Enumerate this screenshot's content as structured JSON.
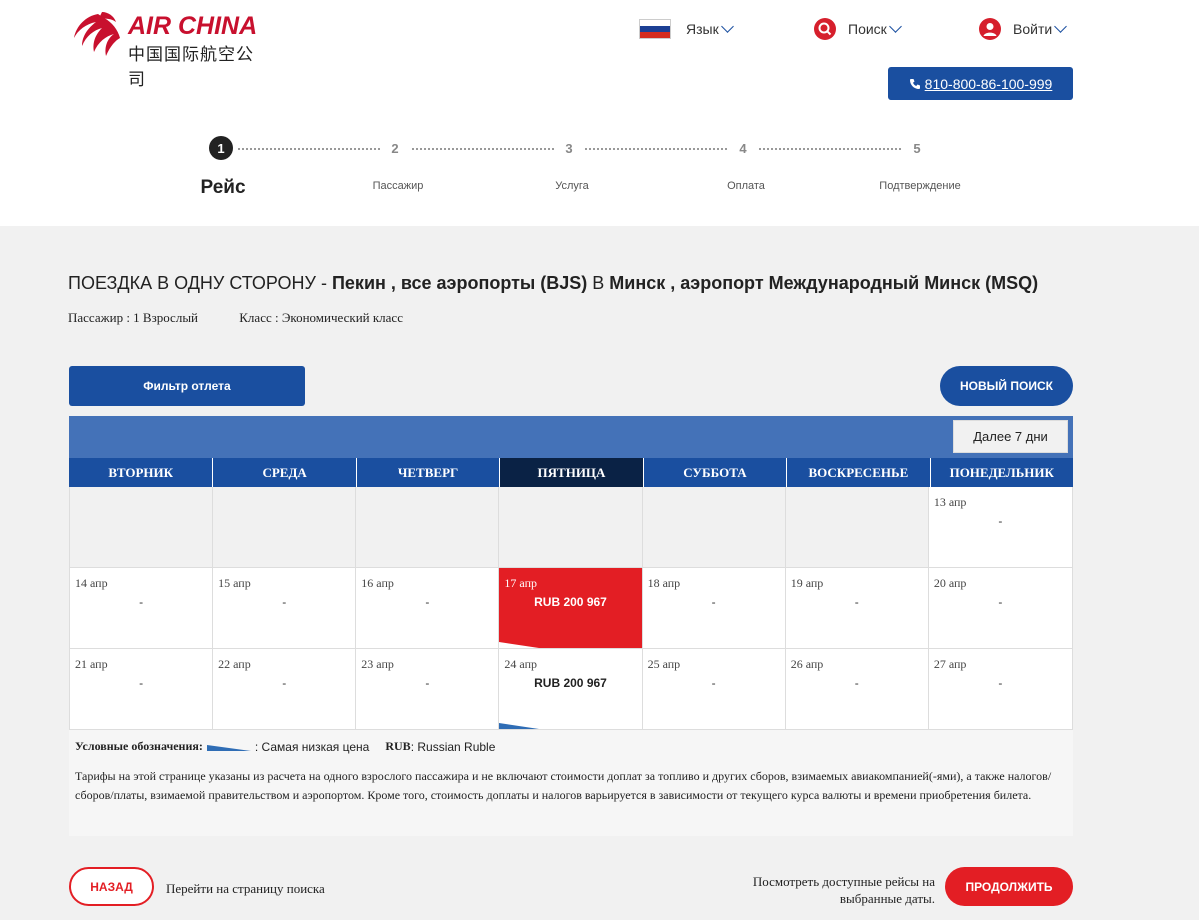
{
  "brand": {
    "name": "AIR CHINA",
    "name_cn": "中国国际航空公司",
    "color": "#c8102e"
  },
  "topnav": {
    "language_label": "Язык",
    "search_label": "Поиск",
    "login_label": "Войти",
    "phone": "810-800-86-100-999"
  },
  "steps": [
    {
      "num": "1",
      "label": "Рейс",
      "active": true
    },
    {
      "num": "2",
      "label": "Пассажир",
      "active": false
    },
    {
      "num": "3",
      "label": "Услуга",
      "active": false
    },
    {
      "num": "4",
      "label": "Оплата",
      "active": false
    },
    {
      "num": "5",
      "label": "Подтверждение",
      "active": false
    }
  ],
  "trip": {
    "type": "ПОЕЗДКА В ОДНУ СТОРОНУ - ",
    "origin": "Пекин , все аэропорты (BJS)",
    "connector": " В ",
    "destination": "Минск , аэропорт Международный Минск (MSQ)",
    "passengers": "Пассажир : 1 Взрослый",
    "cabin": "Класс : Экономический класс"
  },
  "actions": {
    "filter": "Фильтр отлета",
    "new_search": "НОВЫЙ ПОИСК",
    "next_week": "Далее 7 дни"
  },
  "calendar": {
    "weekdays": [
      "ВТОРНИК",
      "СРЕДА",
      "ЧЕТВЕРГ",
      "ПЯТНИЦА",
      "СУББОТА",
      "ВОСКРЕСЕНЬЕ",
      "ПОНЕДЕЛЬНИК"
    ],
    "selected_weekday_index": 3,
    "cells": [
      {
        "date": "",
        "price": ""
      },
      {
        "date": "",
        "price": ""
      },
      {
        "date": "",
        "price": ""
      },
      {
        "date": "",
        "price": ""
      },
      {
        "date": "",
        "price": ""
      },
      {
        "date": "",
        "price": ""
      },
      {
        "date": "13 апр",
        "price": "-"
      },
      {
        "date": "14 апр",
        "price": "-"
      },
      {
        "date": "15 апр",
        "price": "-"
      },
      {
        "date": "16 апр",
        "price": "-"
      },
      {
        "date": "17 апр",
        "price": "RUB 200 967",
        "lowest": true
      },
      {
        "date": "18 апр",
        "price": "-"
      },
      {
        "date": "19 апр",
        "price": "-"
      },
      {
        "date": "20 апр",
        "price": "-"
      },
      {
        "date": "21 апр",
        "price": "-"
      },
      {
        "date": "22 апр",
        "price": "-"
      },
      {
        "date": "23 апр",
        "price": "-"
      },
      {
        "date": "24 апр",
        "price": "RUB 200 967",
        "lowest_marker": true
      },
      {
        "date": "25 апр",
        "price": "-"
      },
      {
        "date": "26 апр",
        "price": "-"
      },
      {
        "date": "27 апр",
        "price": "-"
      }
    ]
  },
  "legend": {
    "title": "Условные обозначения:",
    "lowest_label": ": Самая низкая цена",
    "currency_code": "RUB",
    "currency_name": ": Russian Ruble"
  },
  "notes": "Тарифы на этой странице указаны из расчета на одного взрослого пассажира и не включают стоимости доплат за топливо и других сборов, взимаемых авиакомпанией(-ями), а также налогов/сборов/платы, взимаемой правительством и аэропортом. Кроме того, стоимость доплаты и налогов варьируется в зависимости от текущего курса валюты и времени приобретения билета.",
  "footer": {
    "back": "НАЗАД",
    "back_text": "Перейти на страницу поиска",
    "continue_text": "Посмотреть доступные рейсы на выбранные даты.",
    "continue": "ПРОДОЛЖИТЬ"
  },
  "colors": {
    "primary": "#1a4fa0",
    "accent": "#e31e24",
    "bar": "#4472b8",
    "dark": "#0a2245"
  }
}
